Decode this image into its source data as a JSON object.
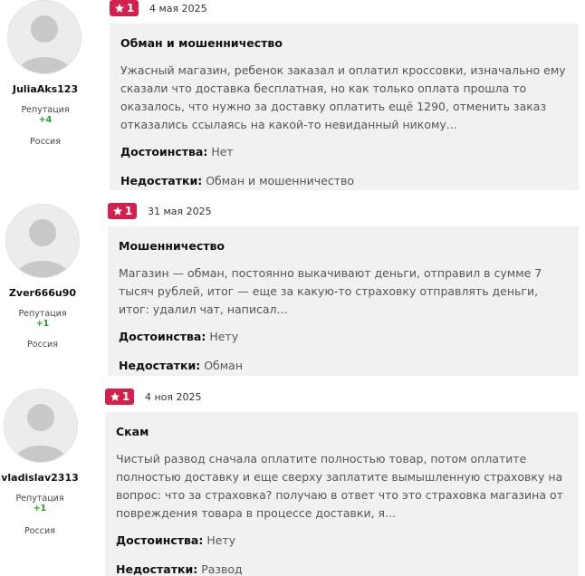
{
  "reviews": [
    {
      "user": {
        "name": "JuliaAks123",
        "reputation_label": "Репутация",
        "reputation_value": "+4",
        "country": "Россия"
      },
      "rating": "1",
      "date": "4 мая 2025",
      "title": "Обман и мошенничество",
      "text": "Ужасный магазин, ребенок заказал и оплатил кроссовки, изначально ему сказали что доставка бесплатная, но как только оплата прошла то оказалось, что нужно за доставку оплатить ещё 1290, отменить заказ отказались ссылаясь на какой-то невиданный никому...",
      "pros_label": "Достоинства:",
      "pros": "Нет",
      "cons_label": "Недостатки:",
      "cons": "Обман и мошенничество"
    },
    {
      "user": {
        "name": "Zver666u90",
        "reputation_label": "Репутация",
        "reputation_value": "+1",
        "country": "Россия"
      },
      "rating": "1",
      "date": "31 мая 2025",
      "title": "Мошенничество",
      "text": "Магазин — обман, постоянно выкачивают деньги, отправил в сумме 7 тысяч рублей, итог — еще за какую-то страховку отправлять деньги, итог: удалил чат, написал...",
      "pros_label": "Достоинства:",
      "pros": "Нету",
      "cons_label": "Недостатки:",
      "cons": "Обман"
    },
    {
      "user": {
        "name": "vladislav2313",
        "reputation_label": "Репутация",
        "reputation_value": "+1",
        "country": "Россия"
      },
      "rating": "1",
      "date": "4 ноя 2025",
      "title": "Скам",
      "text": "Чистый развод сначала оплатите полностью товар, потом оплатите полностью доставку и еще сверху заплатите вымышленную страховку на вопрос: что за страховка? получаю в ответ что это страховка магазина от повреждения товара в процессе доставки, я...",
      "pros_label": "Достоинства:",
      "pros": "Нету",
      "cons_label": "Недостатки:",
      "cons": "Развод"
    }
  ],
  "colors": {
    "rating_badge": "#d0214f",
    "reputation_positive": "#2a9a2a",
    "card_background": "#f1f1f1"
  },
  "icons": {
    "rating": "star-icon",
    "avatar": "user-placeholder-icon"
  }
}
